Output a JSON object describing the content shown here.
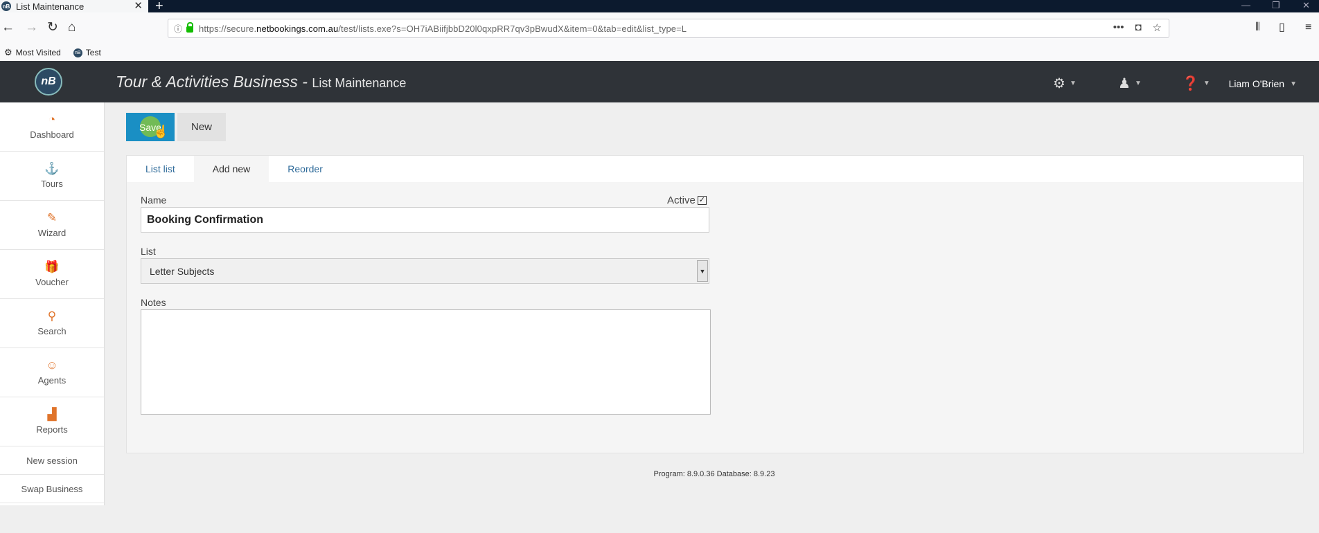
{
  "browser": {
    "tab_title": "List Maintenance",
    "tab_close": "✕",
    "new_tab": "+",
    "url_prefix": "https://secure.",
    "url_domain": "netbookings.com.au",
    "url_rest": "/test/lists.exe?s=OH7iABiifjbbD20l0qxpRR7qv3pBwudX&item=0&tab=edit&list_type=L",
    "bookmarks": [
      "Most Visited",
      "Test"
    ]
  },
  "header": {
    "logo_text": "nB",
    "title": "Tour & Activities Business - ",
    "subtitle": "List Maintenance",
    "user_name": "Liam O'Brien"
  },
  "sidebar": {
    "items": [
      {
        "label": "Dashboard",
        "icon": "dashboard-icon"
      },
      {
        "label": "Tours",
        "icon": "tours-icon"
      },
      {
        "label": "Wizard",
        "icon": "wizard-icon"
      },
      {
        "label": "Voucher",
        "icon": "gift-icon"
      },
      {
        "label": "Search",
        "icon": "search-icon"
      },
      {
        "label": "Agents",
        "icon": "agent-icon"
      },
      {
        "label": "Reports",
        "icon": "chart-icon"
      }
    ],
    "links": [
      "New session",
      "Swap Business"
    ]
  },
  "toolbar": {
    "save_label": "Save",
    "new_label": "New"
  },
  "tabs": [
    "List list",
    "Add new",
    "Reorder"
  ],
  "active_tab": "Add new",
  "form": {
    "name_label": "Name",
    "name_value": "Booking Confirmation",
    "active_label": "Active",
    "active_checked": true,
    "list_label": "List",
    "list_value": "Letter Subjects",
    "notes_label": "Notes",
    "notes_value": ""
  },
  "footer": "Program: 8.9.0.36 Database: 8.9.23",
  "colors": {
    "accent": "#1a8fc4",
    "header_bg": "#2f3338",
    "sidebar_icon": "#e0742b",
    "link": "#2f6b9a"
  }
}
